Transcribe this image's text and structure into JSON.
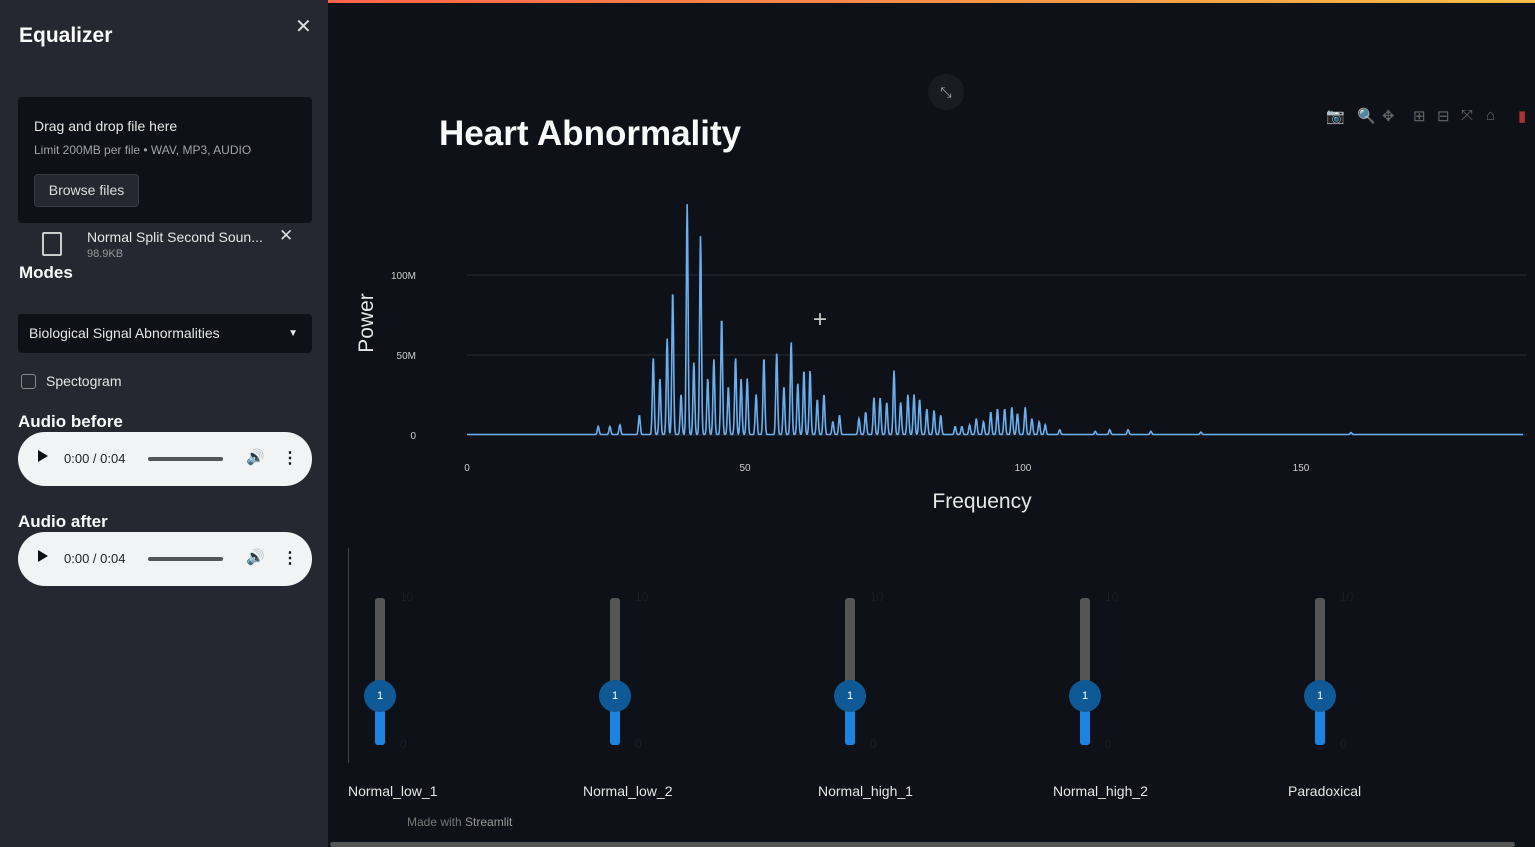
{
  "sidebar": {
    "title": "Equalizer",
    "uploader": {
      "drag_text": "Drag and drop file here",
      "limit_text": "Limit 200MB per file • WAV, MP3, AUDIO",
      "browse_label": "Browse files"
    },
    "file": {
      "name": "Normal Split Second Soun...",
      "size": "98.9KB"
    },
    "modes_label": "Modes",
    "mode_selected": "Biological Signal Abnormalities",
    "spectrogram_label": "Spectogram",
    "spectrogram_checked": false,
    "audio_before": {
      "label": "Audio before",
      "time": "0:00 / 0:04"
    },
    "audio_after": {
      "label": "Audio after",
      "time": "0:00 / 0:04"
    }
  },
  "chart_data": {
    "type": "line",
    "title": "Heart Abnormality",
    "xlabel": "Frequency",
    "ylabel": "Power",
    "xlim": [
      0,
      190
    ],
    "ylim": [
      0,
      150000000
    ],
    "xticks": [
      {
        "v": 0,
        "label": "0"
      },
      {
        "v": 50,
        "label": "50"
      },
      {
        "v": 100,
        "label": "100"
      },
      {
        "v": 150,
        "label": "150"
      }
    ],
    "yticks": [
      {
        "v": 0,
        "label": "0"
      },
      {
        "v": 50000000,
        "label": "50M"
      },
      {
        "v": 100000000,
        "label": "100M"
      }
    ],
    "grid": true,
    "color": "#6ab0f0",
    "peaks_freq_powerM": [
      [
        23.6,
        5
      ],
      [
        25.7,
        5
      ],
      [
        27.5,
        6
      ],
      [
        31,
        12
      ],
      [
        33.5,
        48
      ],
      [
        34.7,
        35
      ],
      [
        36,
        60
      ],
      [
        37,
        90
      ],
      [
        38.5,
        25
      ],
      [
        39.6,
        144
      ],
      [
        40.8,
        45
      ],
      [
        42,
        124
      ],
      [
        43.3,
        35
      ],
      [
        44.4,
        47
      ],
      [
        45.8,
        73
      ],
      [
        47,
        30
      ],
      [
        48.3,
        48
      ],
      [
        49.3,
        35
      ],
      [
        50.4,
        35
      ],
      [
        52,
        25
      ],
      [
        53.4,
        48
      ],
      [
        55.7,
        51
      ],
      [
        57,
        30
      ],
      [
        58.3,
        58
      ],
      [
        59.5,
        32
      ],
      [
        60.6,
        40
      ],
      [
        61.7,
        40
      ],
      [
        63,
        22
      ],
      [
        64.2,
        25
      ],
      [
        65.8,
        8
      ],
      [
        67,
        12
      ],
      [
        70.5,
        10
      ],
      [
        71.7,
        14
      ],
      [
        73.2,
        23
      ],
      [
        74.3,
        23
      ],
      [
        75.5,
        20
      ],
      [
        76.8,
        40
      ],
      [
        78,
        20
      ],
      [
        79.3,
        25
      ],
      [
        80.4,
        25
      ],
      [
        81.4,
        22
      ],
      [
        82.7,
        16
      ],
      [
        84,
        15
      ],
      [
        85.2,
        12
      ],
      [
        87.8,
        5
      ],
      [
        89,
        5
      ],
      [
        90.4,
        6
      ],
      [
        91.6,
        10
      ],
      [
        92.9,
        8
      ],
      [
        94.2,
        14
      ],
      [
        95.4,
        16
      ],
      [
        96.7,
        16
      ],
      [
        98,
        17
      ],
      [
        99,
        13
      ],
      [
        100.4,
        17
      ],
      [
        101.6,
        10
      ],
      [
        102.9,
        8
      ],
      [
        104,
        6
      ],
      [
        106.6,
        3
      ],
      [
        113,
        2
      ],
      [
        115.6,
        3
      ],
      [
        118.9,
        3
      ],
      [
        123,
        2
      ],
      [
        132,
        1.5
      ],
      [
        159,
        1.2
      ]
    ]
  },
  "toolbar_icons": [
    "camera-icon",
    "zoom-icon",
    "pan-icon",
    "zoom-in-icon",
    "zoom-out-icon",
    "autoscale-icon",
    "home-icon",
    "plotly-logo-icon"
  ],
  "sliders": [
    {
      "label": "Normal_low_1",
      "value": 1,
      "min": 0,
      "max": 10,
      "value_label": "1",
      "min_label": "0",
      "max_label": "10"
    },
    {
      "label": "Normal_low_2",
      "value": 1,
      "min": 0,
      "max": 10,
      "value_label": "1",
      "min_label": "0",
      "max_label": "10"
    },
    {
      "label": "Normal_high_1",
      "value": 1,
      "min": 0,
      "max": 10,
      "value_label": "1",
      "min_label": "0",
      "max_label": "10"
    },
    {
      "label": "Normal_high_2",
      "value": 1,
      "min": 0,
      "max": 10,
      "value_label": "1",
      "min_label": "0",
      "max_label": "10"
    },
    {
      "label": "Paradoxical",
      "value": 1,
      "min": 0,
      "max": 10,
      "value_label": "1",
      "min_label": "0",
      "max_label": "10"
    }
  ],
  "footer": {
    "made_with": "Made with",
    "brand": "Streamlit"
  }
}
